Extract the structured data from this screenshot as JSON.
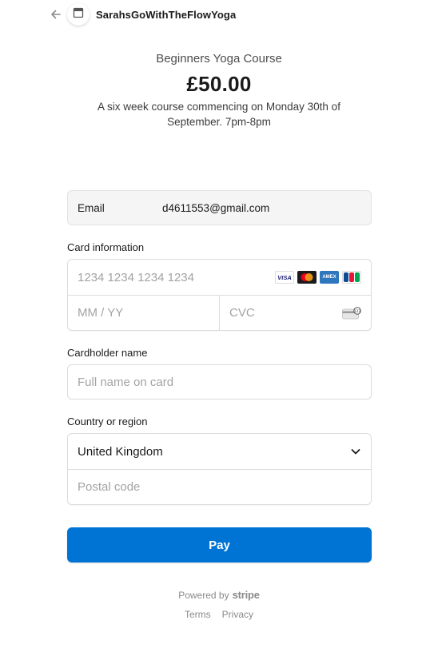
{
  "header": {
    "merchant_name": "SarahsGoWithTheFlowYoga"
  },
  "product": {
    "name": "Beginners Yoga Course",
    "price": "£50.00",
    "description": "A six week course commencing on Monday 30th of September. 7pm-8pm"
  },
  "email": {
    "label": "Email",
    "value": "d4611553@gmail.com"
  },
  "card": {
    "label": "Card information",
    "number_placeholder": "1234 1234 1234 1234",
    "expiry_placeholder": "MM / YY",
    "cvc_placeholder": "CVC",
    "brands": [
      "VISA",
      "Mastercard",
      "AMEX",
      "JCB"
    ],
    "visa_text": "VISA",
    "amex_text": "AMEX"
  },
  "cardholder": {
    "label": "Cardholder name",
    "placeholder": "Full name on card"
  },
  "country": {
    "label": "Country or region",
    "selected": "United Kingdom",
    "postal_placeholder": "Postal code"
  },
  "pay_button": {
    "label": "Pay",
    "color": "#0074d4"
  },
  "footer": {
    "powered_by": "Powered by",
    "brand": "stripe",
    "terms": "Terms",
    "privacy": "Privacy"
  }
}
